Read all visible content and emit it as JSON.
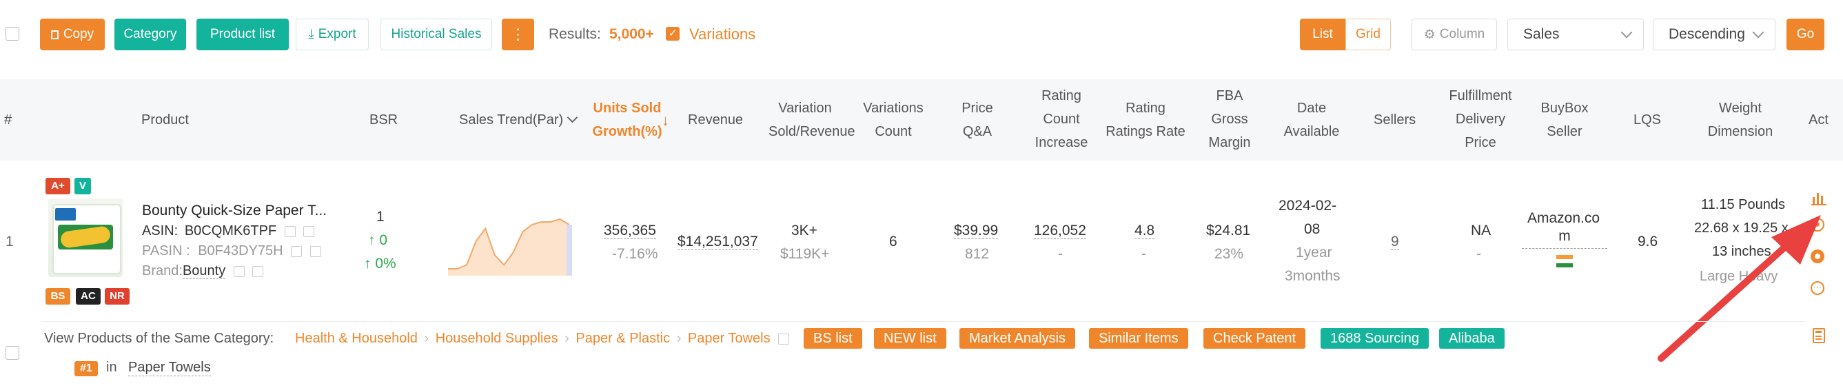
{
  "toolbar": {
    "copy": "Copy",
    "category": "Category",
    "product_list": "Product list",
    "export": "Export",
    "historical_sales": "Historical Sales",
    "results_label": "Results:",
    "results_value": "5,000+",
    "variations": "Variations",
    "list": "List",
    "grid": "Grid",
    "column": "Column",
    "sort_field": "Sales",
    "sort_order": "Descending",
    "go": "Go"
  },
  "headers": {
    "index": "#",
    "product": "Product",
    "bsr": "BSR",
    "sales_trend": "Sales Trend(Par)",
    "units_sold_1": "Units Sold",
    "units_sold_2": "Growth(%)",
    "revenue": "Revenue",
    "variation_1": "Variation",
    "variation_2": "Sold/Revenue",
    "variations_count_1": "Variations",
    "variations_count_2": "Count",
    "price_1": "Price",
    "price_2": "Q&A",
    "rating_1": "Rating",
    "rating_2": "Count",
    "rating_3": "Increase",
    "ratings_1": "Rating",
    "ratings_2": "Ratings Rate",
    "fba_1": "FBA",
    "fba_2": "Gross",
    "fba_3": "Margin",
    "date_1": "Date",
    "date_2": "Available",
    "sellers": "Sellers",
    "fulfillment_1": "Fulfillment",
    "fulfillment_2": "Delivery",
    "fulfillment_3": "Price",
    "buybox_1": "BuyBox",
    "buybox_2": "Seller",
    "lqs": "LQS",
    "weight_1": "Weight",
    "weight_2": "Dimension",
    "act": "Act"
  },
  "row": {
    "index": "1",
    "badges": {
      "aplus": "A+",
      "v": "V",
      "bs": "BS",
      "ac": "AC",
      "nr": "NR"
    },
    "title": "Bounty Quick-Size Paper T...",
    "asin_label": "ASIN:",
    "asin": "B0CQMK6TPF",
    "pasin_label": "PASIN :",
    "pasin": "B0F43DY75H",
    "brand_label": "Brand:",
    "brand": "Bounty",
    "bsr": "1",
    "bsr_change_1": "↑ 0",
    "bsr_change_2": "↑ 0%",
    "units_sold": "356,365",
    "units_growth": "-7.16%",
    "revenue": "$14,251,037",
    "variation_sold": "3K+",
    "variation_revenue": "$119K+",
    "variations_count": "6",
    "price": "$39.99",
    "qa": "812",
    "rating_count": "126,052",
    "rating_increase": "-",
    "rating": "4.8",
    "ratings_rate": "-",
    "fba": "$24.81",
    "margin": "23%",
    "date_1": "2024-02-",
    "date_2": "08",
    "age_1": "1year",
    "age_2": "3months",
    "sellers": "9",
    "fulfillment": "NA",
    "fulfillment_dash": "-",
    "buybox_1": "Amazon.co",
    "buybox_2": "m",
    "lqs": "9.6",
    "weight": "11.15 Pounds",
    "dim_1": "22.68 x 19.25 x",
    "dim_2": "13 inches",
    "size": "Large Heavy"
  },
  "category_bar": {
    "label": "View Products of the Same Category:",
    "crumbs": [
      "Health & Household",
      "Household Supplies",
      "Paper & Plastic",
      "Paper Towels"
    ],
    "tags": [
      "BS list",
      "NEW list",
      "Market Analysis",
      "Similar Items",
      "Check Patent",
      "1688 Sourcing",
      "Alibaba"
    ],
    "rank": "#1",
    "rank_in": "in",
    "rank_category": "Paper Towels"
  },
  "sparkline": [
    0.05,
    0.05,
    0.12,
    0.55,
    0.78,
    0.3,
    0.12,
    0.35,
    0.72,
    0.85,
    0.9,
    0.9,
    0.95,
    0.85
  ],
  "colors": {
    "orange": "#f0862b",
    "teal": "#14b39b",
    "red_arrow": "#e8413f"
  }
}
